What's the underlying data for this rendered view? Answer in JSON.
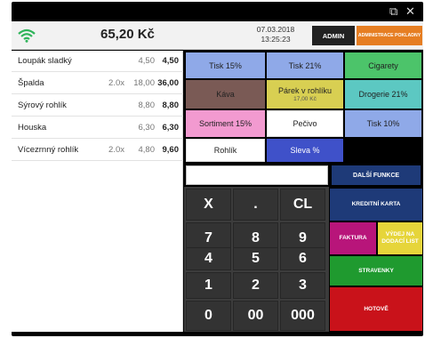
{
  "window": {
    "restore_icon": "⧉",
    "close_icon": "✕"
  },
  "header": {
    "wifi_icon": "wifi-icon",
    "total": "65,20 Kč",
    "date": "07.03.2018",
    "time": "13:25:23",
    "admin_label": "ADMIN",
    "admin_pokladny_label": "ADMINISTRACE POKLADNY"
  },
  "items": [
    {
      "name": "Loupák sladký",
      "qty": "",
      "price": "4,50",
      "total": "4,50"
    },
    {
      "name": "Špalda",
      "qty": "2.0x",
      "price": "18,00",
      "total": "36,00"
    },
    {
      "name": "Sýrový rohlík",
      "qty": "",
      "price": "8,80",
      "total": "8,80"
    },
    {
      "name": "Houska",
      "qty": "",
      "price": "6,30",
      "total": "6,30"
    },
    {
      "name": "Vícezrnný rohlík",
      "qty": "2.0x",
      "price": "4,80",
      "total": "9,60"
    }
  ],
  "categories": [
    {
      "label": "Tisk 15%",
      "sub": ""
    },
    {
      "label": "Tisk 21%",
      "sub": ""
    },
    {
      "label": "Cigarety",
      "sub": ""
    },
    {
      "label": "Káva",
      "sub": ""
    },
    {
      "label": "Párek v rohlíku",
      "sub": "17,00 Kč"
    },
    {
      "label": "Drogerie 21%",
      "sub": ""
    },
    {
      "label": "Sortiment 15%",
      "sub": ""
    },
    {
      "label": "Pečivo",
      "sub": ""
    },
    {
      "label": "Tisk 10%",
      "sub": ""
    },
    {
      "label": "Rohlík",
      "sub": ""
    },
    {
      "label": "Sleva %",
      "sub": ""
    }
  ],
  "colors": {
    "tisk15": "#8fa9e8",
    "tisk21": "#8fa9e8",
    "cigarety": "#4cc46a",
    "kava": "#7a5a55",
    "parek": "#d8cf52",
    "drogerie": "#5cc8c2",
    "sortiment": "#f29ad0",
    "pecivo": "#ffffff",
    "tisk10": "#8fa9e8",
    "rohlik": "#ffffff",
    "sleva": "#3f51c9",
    "kreditni": "#1e3a78",
    "faktura": "#b8157a",
    "vydej": "#e6d53a",
    "stravenky": "#1f9a2f",
    "hotove": "#c9121a"
  },
  "input": {
    "value": ""
  },
  "buttons": {
    "dalsi_funkce": "DALŠÍ FUNKCE",
    "kreditni_karta": "KREDITNÍ KARTA",
    "faktura": "FAKTURA",
    "vydej": "VÝDEJ NA DODACÍ LIST",
    "stravenky": "STRAVENKY",
    "hotove": "HOTOVĚ"
  },
  "keypad": [
    "X",
    ".",
    "CL",
    "7",
    "8",
    "9",
    "4",
    "5",
    "6",
    "1",
    "2",
    "3",
    "0",
    "00",
    "000"
  ]
}
